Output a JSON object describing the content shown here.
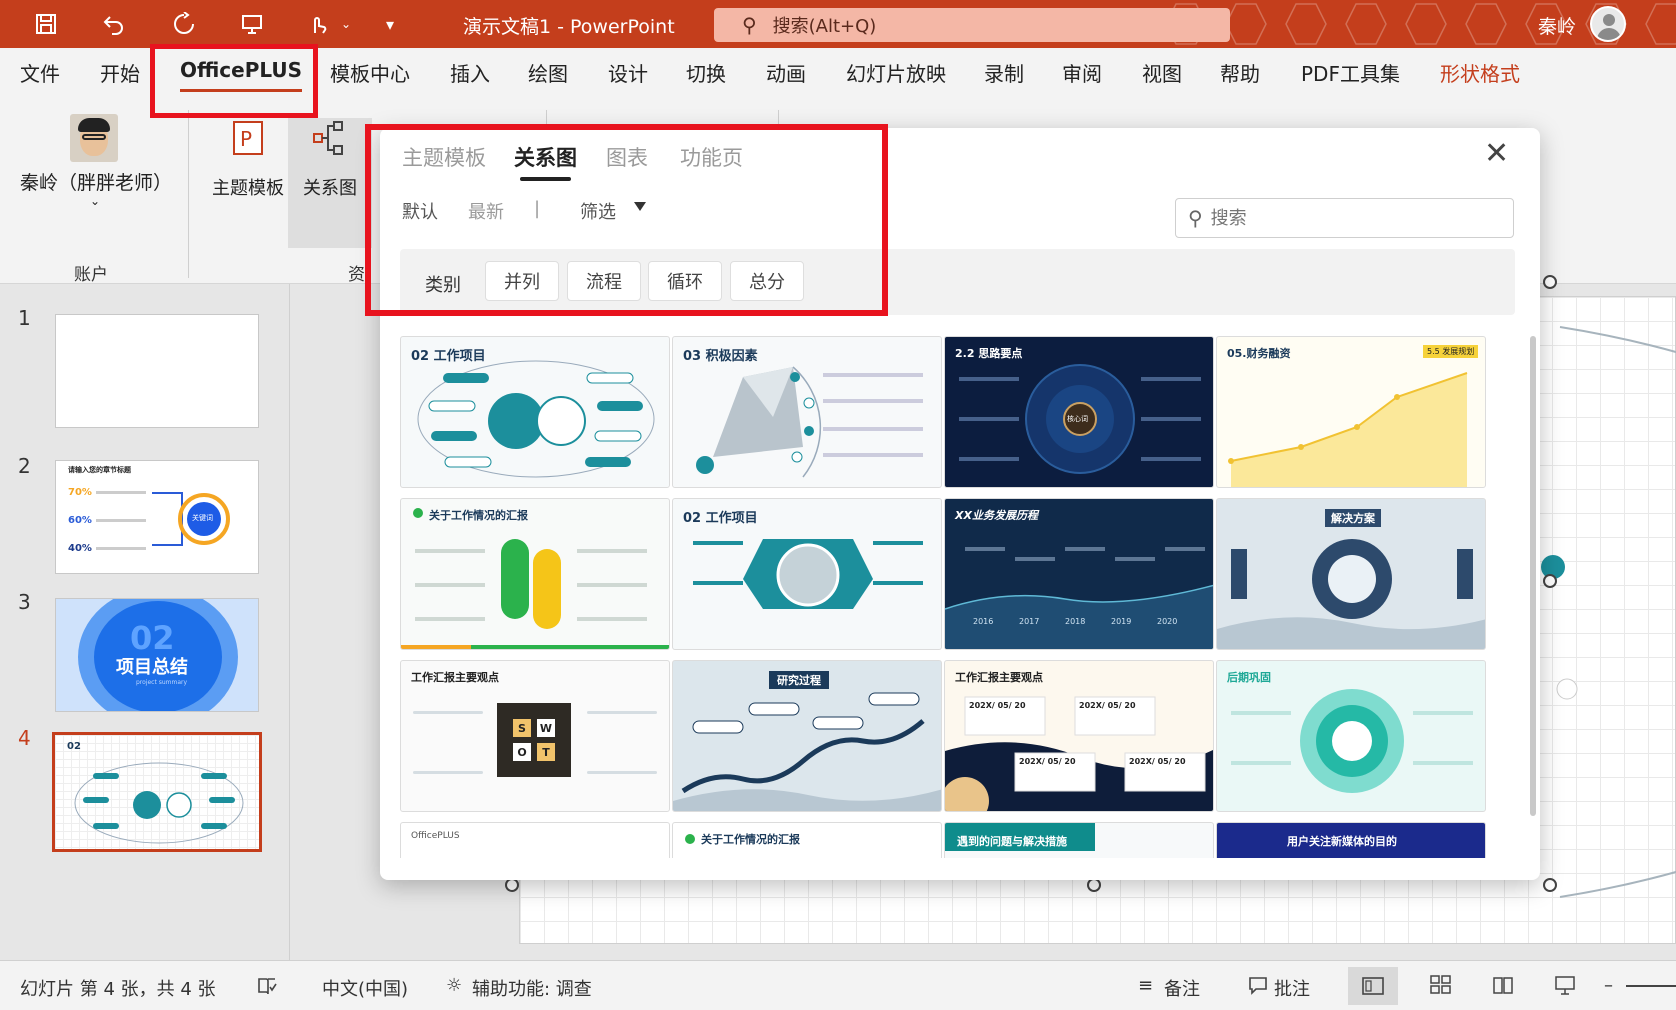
{
  "titlebar": {
    "doc_title": "演示文稿1  -  PowerPoint",
    "search_placeholder": "搜索(Alt+Q)",
    "user_name": "秦岭",
    "accent_color": "#c43e1c"
  },
  "ribbon_tabs": [
    {
      "label": "文件"
    },
    {
      "label": "开始"
    },
    {
      "label": "OfficePLUS"
    },
    {
      "label": "模板中心"
    },
    {
      "label": "插入"
    },
    {
      "label": "绘图"
    },
    {
      "label": "设计"
    },
    {
      "label": "切换"
    },
    {
      "label": "动画"
    },
    {
      "label": "幻灯片放映"
    },
    {
      "label": "录制"
    },
    {
      "label": "审阅"
    },
    {
      "label": "视图"
    },
    {
      "label": "帮助"
    },
    {
      "label": "PDF工具集"
    },
    {
      "label": "形状格式"
    }
  ],
  "ribbon": {
    "account_name": "秦岭（胖胖老师）",
    "account_group": "账户",
    "resource_group": "资",
    "btn_theme": "主题模板",
    "btn_relation": "关系图"
  },
  "slides": [
    {
      "num": "1"
    },
    {
      "num": "2",
      "title": "请输入您的章节标题",
      "p1": "70%",
      "p2": "60%",
      "p3": "40%",
      "center": "关键词"
    },
    {
      "num": "3",
      "big": "02",
      "text": "项目总结",
      "sub": "project summary"
    },
    {
      "num": "4"
    }
  ],
  "popup": {
    "tabs": [
      "主题模板",
      "关系图",
      "图表",
      "功能页"
    ],
    "sort_default": "默认",
    "sort_latest": "最新",
    "divider": "|",
    "filter": "筛选",
    "search_placeholder": "搜索",
    "category_label": "类别",
    "categories": [
      "并列",
      "流程",
      "循环",
      "总分"
    ],
    "cards": [
      {
        "caption": "02 工作项目"
      },
      {
        "caption": "03 积极因素"
      },
      {
        "caption": "2.2 思路要点",
        "center": "核心词"
      },
      {
        "caption": "05.财务融资",
        "tag": "5.5 发展规划"
      },
      {
        "caption": "关于工作情况的汇报"
      },
      {
        "caption": "02 工作项目"
      },
      {
        "caption": "XX业务发展历程",
        "years": [
          "2016",
          "2017",
          "2018",
          "2019",
          "2020"
        ]
      },
      {
        "caption": "解决方案"
      },
      {
        "caption": "工作汇报主要观点",
        "swot": [
          "S",
          "W",
          "O",
          "T"
        ]
      },
      {
        "caption": "研究过程"
      },
      {
        "caption": "工作汇报主要观点",
        "dates": [
          "202X/ 05/ 20",
          "202X/ 05/ 20",
          "202X/ 05/ 20",
          "202X/ 05/ 20"
        ]
      },
      {
        "caption": "后期巩固"
      },
      {
        "caption": "OfficePLUS"
      },
      {
        "caption": "关于工作情况的汇报"
      },
      {
        "caption": "遇到的问题与解决措施"
      },
      {
        "caption": "用户关注新媒体的目的"
      }
    ]
  },
  "statusbar": {
    "slide_info": "幻灯片 第 4 张，共 4 张",
    "language": "中文(中国)",
    "accessibility": "辅助功能: 调查",
    "notes": "备注",
    "comments": "批注"
  }
}
